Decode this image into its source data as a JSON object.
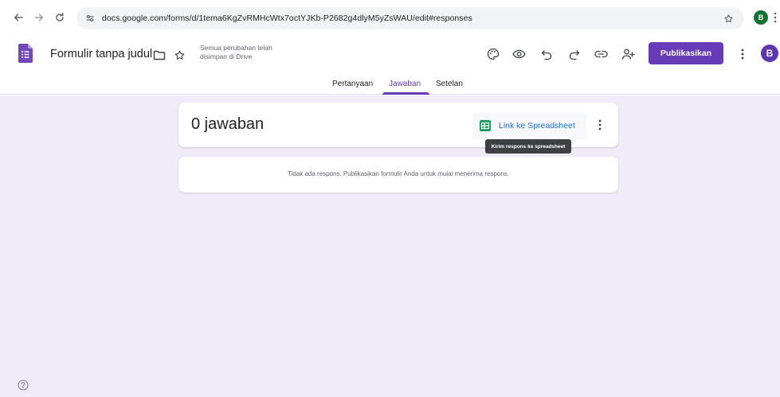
{
  "browser": {
    "url": "docs.google.com/forms/d/1tema6KgZvRMHcWtx7octYJKb-P2682g4dlyM5yZsWAU/edit#responses",
    "avatar_letter": "B"
  },
  "header": {
    "title": "Formulir tanpa judul",
    "save_status": "Semua perubahan telah disimpan di Drive",
    "publish_label": "Publikasikan",
    "avatar_letter": "B"
  },
  "tabs": [
    {
      "label": "Pertanyaan",
      "active": false
    },
    {
      "label": "Jawaban",
      "active": true
    },
    {
      "label": "Setelan",
      "active": false
    }
  ],
  "responses": {
    "count_label": "0 jawaban",
    "link_sheet_label": "Link ke Spreadsheet",
    "tooltip": "Kirim respons ke spreadsheet",
    "empty_message": "Tidak ada respons. Publikasikan formulir Anda untuk mulai menerima respons."
  },
  "colors": {
    "accent": "#673ab7",
    "background": "#f0ebf8",
    "link": "#1a73e8",
    "sheets_green": "#0f9d58"
  },
  "icons": [
    "back-icon",
    "forward-icon",
    "reload-icon",
    "site-info-icon",
    "bookmark-star-icon",
    "forms-logo-icon",
    "folder-icon",
    "star-icon",
    "palette-icon",
    "preview-eye-icon",
    "undo-icon",
    "redo-icon",
    "link-icon",
    "add-collaborator-icon",
    "more-vert-icon",
    "sheets-icon",
    "help-icon"
  ]
}
